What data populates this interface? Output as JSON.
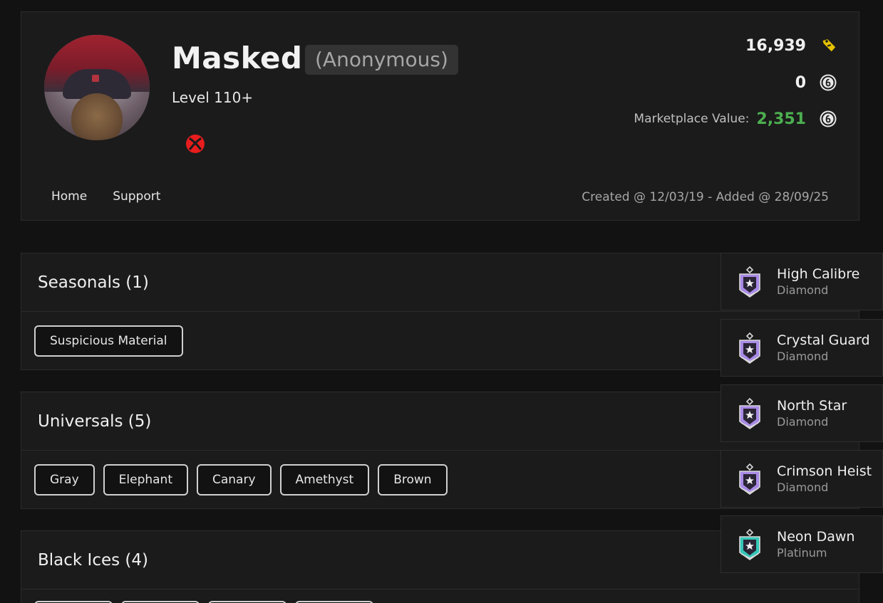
{
  "profile": {
    "name": "Masked",
    "anon_label": "(Anonymous)",
    "level": "Level 110+",
    "platform_icon": "xbox-icon",
    "credits": "16,939",
    "credits_icon": "credits-tag-icon",
    "coins": "0",
    "coins_icon": "r6-coin-icon",
    "market_label": "Marketplace Value:",
    "market_value": "2,351",
    "dates": "Created @ 12/03/19 - Added @ 28/09/25"
  },
  "nav": {
    "home": "Home",
    "support": "Support"
  },
  "sections": {
    "seasonals": {
      "title": "Seasonals (1)",
      "items": [
        "Suspicious Material"
      ]
    },
    "universals": {
      "title": "Universals (5)",
      "items": [
        "Gray",
        "Elephant",
        "Canary",
        "Amethyst",
        "Brown"
      ]
    },
    "blackices": {
      "title": "Black Ices (4)"
    }
  },
  "ranks": [
    {
      "name": "High Calibre",
      "tier": "Diamond",
      "color": "#a98ae6"
    },
    {
      "name": "Crystal Guard",
      "tier": "Diamond",
      "color": "#a98ae6"
    },
    {
      "name": "North Star",
      "tier": "Diamond",
      "color": "#a98ae6"
    },
    {
      "name": "Crimson Heist",
      "tier": "Diamond",
      "color": "#a98ae6"
    },
    {
      "name": "Neon Dawn",
      "tier": "Platinum",
      "color": "#35c7b8"
    }
  ],
  "colors": {
    "market_value": "#4caf50",
    "xbox": "#e81d1d",
    "credits_tag": "#e6c200"
  }
}
